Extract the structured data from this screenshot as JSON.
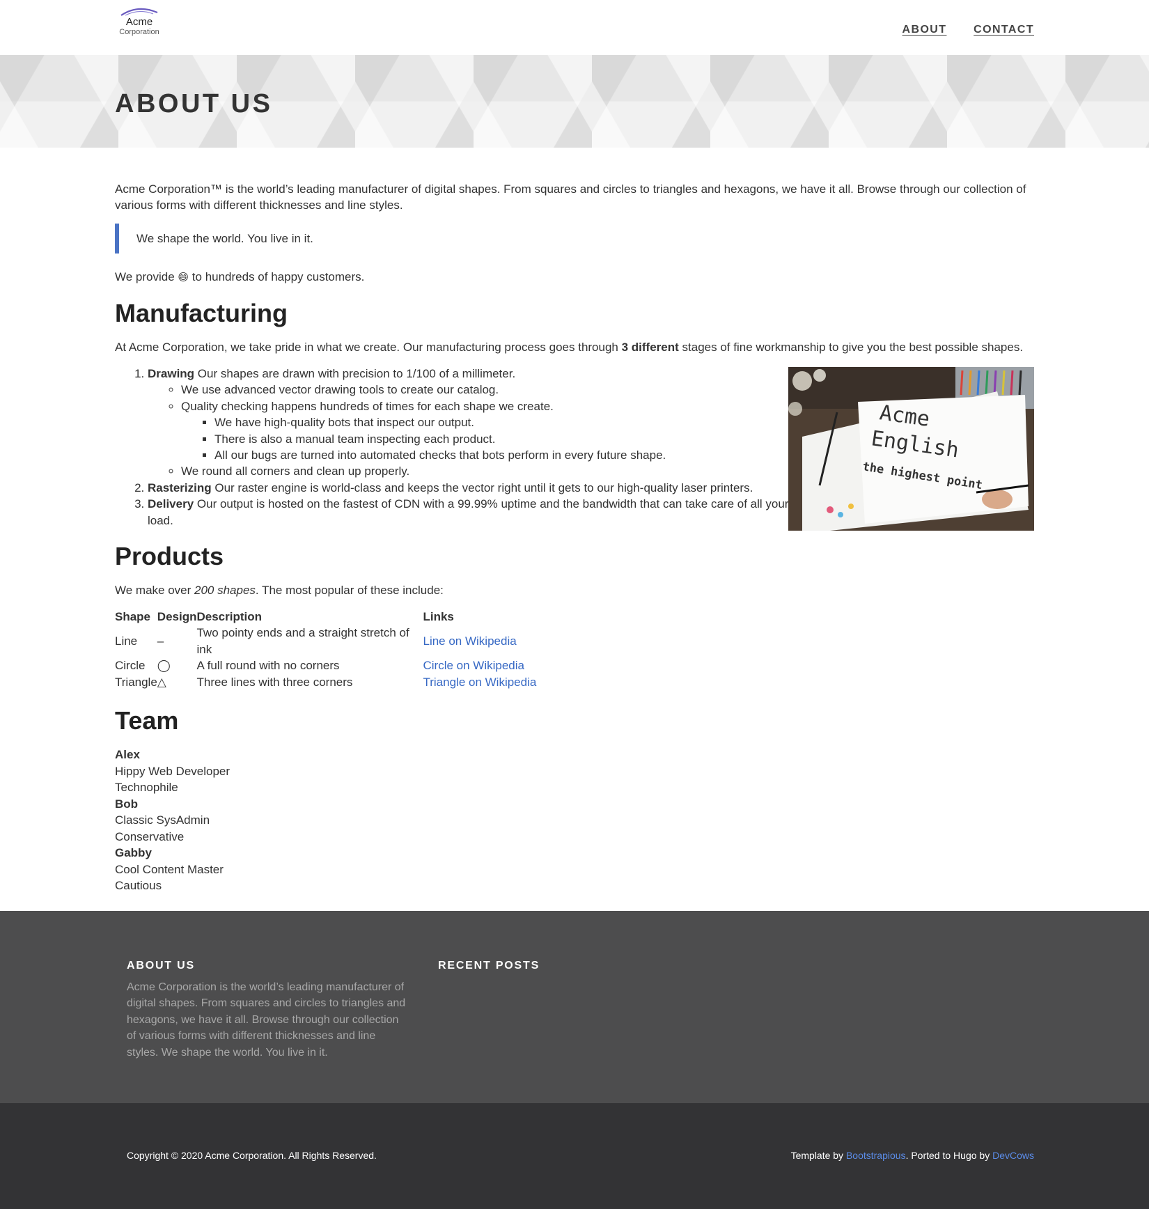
{
  "header": {
    "logo_line1": "Acme",
    "logo_line2": "Corporation",
    "nav": {
      "about": "ABOUT",
      "contact": "CONTACT"
    }
  },
  "banner": {
    "title": "ABOUT US"
  },
  "intro": {
    "text": "Acme Corporation™ is the world’s leading manufacturer of digital shapes. From squares and circles to triangles and hexagons, we have it all. Browse through our collection of various forms with different thicknesses and line styles.",
    "quote": "We shape the world. You live in it.",
    "provide_before": "We provide",
    "provide_emoji": "😄",
    "provide_after": "to hundreds of happy customers."
  },
  "manufacturing": {
    "heading": "Manufacturing",
    "text_before": "At Acme Corporation, we take pride in what we create. Our manufacturing process goes through",
    "text_bold": "3 different",
    "text_after": "stages of fine workmanship to give you the best possible shapes.",
    "image": {
      "line1": "Acme",
      "line2": "English",
      "line3": "the highest point"
    },
    "stages": [
      {
        "title": "Drawing",
        "text": "Our shapes are drawn with precision to 1/100 of a millimeter.",
        "sub": [
          "We use advanced vector drawing tools to create our catalog.",
          "Quality checking happens hundreds of times for each shape we create.",
          "We round all corners and clean up properly."
        ],
        "subsub": [
          "We have high-quality bots that inspect our output.",
          "There is also a manual team inspecting each product.",
          "All our bugs are turned into automated checks that bots perform in every future shape."
        ]
      },
      {
        "title": "Rasterizing",
        "text": "Our raster engine is world-class and keeps the vector right until it gets to our high-quality laser printers."
      },
      {
        "title": "Delivery",
        "text": "Our output is hosted on the fastest of CDN with a 99.99% uptime and the bandwidth that can take care of all your load."
      }
    ]
  },
  "products": {
    "heading": "Products",
    "text_before": "We make over",
    "text_em": "200 shapes",
    "text_after": ". The most popular of these include:",
    "columns": [
      "Shape",
      "Design",
      "Description",
      "Links"
    ],
    "rows": [
      {
        "shape": "Line",
        "design": "–",
        "description": "Two pointy ends and a straight stretch of ink",
        "link": "Line on Wikipedia"
      },
      {
        "shape": "Circle",
        "design": "◯",
        "description": "A full round with no corners",
        "link": "Circle on Wikipedia"
      },
      {
        "shape": "Triangle",
        "design": "△",
        "description": "Three lines with three corners",
        "link": "Triangle on Wikipedia"
      }
    ]
  },
  "team": {
    "heading": "Team",
    "members": [
      {
        "name": "Alex",
        "role": "Hippy Web Developer",
        "trait": "Technophile"
      },
      {
        "name": "Bob",
        "role": "Classic SysAdmin",
        "trait": "Conservative"
      },
      {
        "name": "Gabby",
        "role": "Cool Content Master",
        "trait": "Cautious"
      }
    ]
  },
  "footer": {
    "about_heading": "ABOUT US",
    "about_text": "Acme Corporation is the world’s leading manufacturer of digital shapes. From squares and circles to triangles and hexagons, we have it all. Browse through our collection of various forms with different thicknesses and line styles. We shape the world. You live in it.",
    "recent_heading": "RECENT POSTS",
    "copyright": "Copyright © 2020 Acme Corporation. All Rights Reserved.",
    "template_by": "Template by",
    "template_link": "Bootstrapious",
    "ported_by": ". Ported to Hugo by",
    "ported_link": "DevCows"
  },
  "colors": {
    "accent": "#4a73c4",
    "link": "#3668c4",
    "footer_bg": "#4d4d4e",
    "bottombar_bg": "#333335"
  }
}
